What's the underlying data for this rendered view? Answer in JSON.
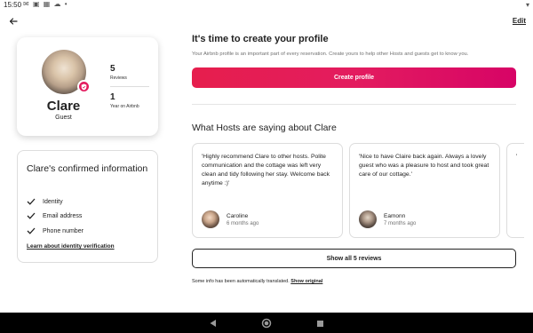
{
  "status_bar": {
    "time": "15:50",
    "icons": [
      "mail-icon",
      "photo-icon",
      "calendar-icon",
      "cloud-icon",
      "dot-icon"
    ],
    "right_icons": [
      "wifi-icon"
    ]
  },
  "header": {
    "edit_label": "Edit"
  },
  "profile": {
    "name": "Clare",
    "role": "Guest",
    "stats": [
      {
        "value": "5",
        "label": "Reviews"
      },
      {
        "value": "1",
        "label": "Year on Airbnb"
      }
    ]
  },
  "confirmed": {
    "title": "Clare's confirmed information",
    "items": [
      "Identity",
      "Email address",
      "Phone number"
    ],
    "learn_link": "Learn about identity verification"
  },
  "create_profile": {
    "title": "It's time to create your profile",
    "description": "Your Airbnb profile is an important part of every reservation. Create yours to help other Hosts and guests get to know you.",
    "button_label": "Create profile"
  },
  "hosts": {
    "title": "What Hosts are saying about Clare",
    "reviews": [
      {
        "text": "'Highly recommend Clare to other hosts. Polite communication and the cottage was left very clean and tidy following her stay. Welcome back anytime :)'",
        "name": "Caroline",
        "time": "6 months ago"
      },
      {
        "text": "'Nice to have Claire back again. Always a lovely guest who was a pleasure to host and took great care of our cottage.'",
        "name": "Eamonn",
        "time": "7 months ago"
      },
      {
        "text": "'",
        "name": "",
        "time": ""
      }
    ],
    "show_all_label": "Show all 5 reviews",
    "translate_note": "Some info has been automatically translated.",
    "show_original": "Show original"
  },
  "colors": {
    "brand": "#e31c5f",
    "text": "#222222",
    "muted": "#717171",
    "border": "#dddddd"
  }
}
